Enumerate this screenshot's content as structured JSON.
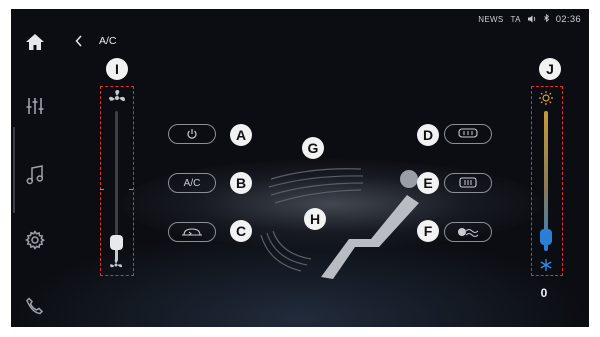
{
  "status_bar": {
    "news": "NEWS",
    "ta": "TA",
    "volume_icon": "speaker-icon",
    "bluetooth_icon": "bluetooth-icon",
    "time": "02:36"
  },
  "header": {
    "title": "A/C"
  },
  "sidebar": {
    "items": [
      {
        "name": "home",
        "icon": "home-icon"
      },
      {
        "name": "equalizer",
        "icon": "sliders-icon"
      },
      {
        "name": "music",
        "icon": "music-note-icon"
      },
      {
        "name": "settings",
        "icon": "gear-icon"
      },
      {
        "name": "phone",
        "icon": "phone-icon"
      }
    ]
  },
  "buttons": {
    "power": {
      "icon": "power-icon",
      "callout": "A"
    },
    "ac": {
      "label": "A/C",
      "callout": "B"
    },
    "recirculation": {
      "icon": "recirculation-icon",
      "callout": "C"
    },
    "rear_defrost": {
      "icon": "rear-defrost-icon",
      "callout": "D"
    },
    "front_defrost": {
      "icon": "front-defrost-icon",
      "callout": "E"
    },
    "seat_airflow": {
      "icon": "seat-airflow-icon",
      "callout": "F"
    }
  },
  "callouts": {
    "upper_airflow": "G",
    "lower_airflow": "H",
    "fan_slider": "I",
    "temp_slider": "J"
  },
  "fan_slider": {
    "top_icon": "fan-high-icon",
    "bottom_icon": "fan-low-icon",
    "level": 0.12
  },
  "temp_slider": {
    "top_icon": "sun-icon",
    "bottom_icon": "snowflake-icon",
    "level": 0.1,
    "value": "0"
  },
  "colors": {
    "background": "#0b0d12",
    "callout_fill": "#f2f2f2",
    "highlight_dash": "#e0322d",
    "temp_cold": "#2a7fd6",
    "temp_warm": "#c79a3a"
  }
}
